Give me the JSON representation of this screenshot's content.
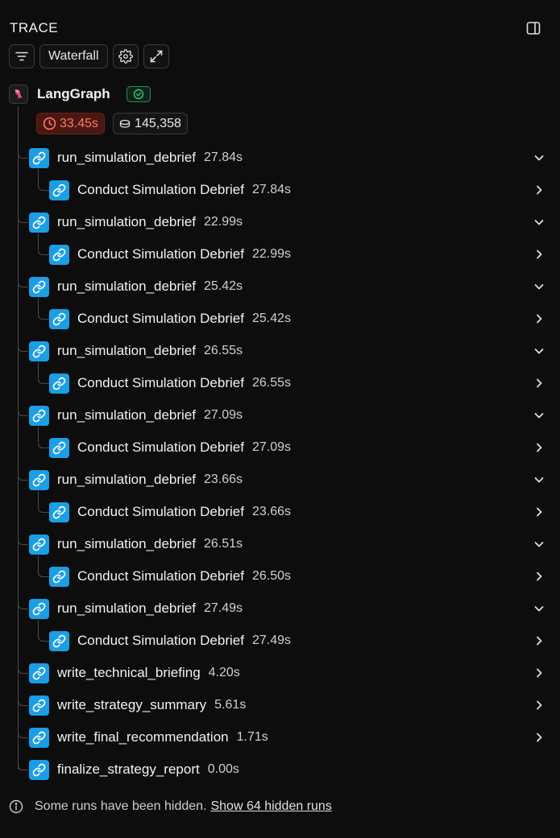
{
  "panel": {
    "title": "TRACE"
  },
  "toolbar": {
    "view_label": "Waterfall"
  },
  "root": {
    "name": "LangGraph",
    "status": "success",
    "duration": "33.45s",
    "tokens": "145,358"
  },
  "runs": [
    {
      "name": "run_simulation_debrief",
      "duration": "27.84s",
      "expanded": true,
      "children": [
        {
          "name": "Conduct Simulation Debrief",
          "duration": "27.84s"
        }
      ]
    },
    {
      "name": "run_simulation_debrief",
      "duration": "22.99s",
      "expanded": true,
      "children": [
        {
          "name": "Conduct Simulation Debrief",
          "duration": "22.99s"
        }
      ]
    },
    {
      "name": "run_simulation_debrief",
      "duration": "25.42s",
      "expanded": true,
      "children": [
        {
          "name": "Conduct Simulation Debrief",
          "duration": "25.42s"
        }
      ]
    },
    {
      "name": "run_simulation_debrief",
      "duration": "26.55s",
      "expanded": true,
      "children": [
        {
          "name": "Conduct Simulation Debrief",
          "duration": "26.55s"
        }
      ]
    },
    {
      "name": "run_simulation_debrief",
      "duration": "27.09s",
      "expanded": true,
      "children": [
        {
          "name": "Conduct Simulation Debrief",
          "duration": "27.09s"
        }
      ]
    },
    {
      "name": "run_simulation_debrief",
      "duration": "23.66s",
      "expanded": true,
      "children": [
        {
          "name": "Conduct Simulation Debrief",
          "duration": "23.66s"
        }
      ]
    },
    {
      "name": "run_simulation_debrief",
      "duration": "26.51s",
      "expanded": true,
      "children": [
        {
          "name": "Conduct Simulation Debrief",
          "duration": "26.50s"
        }
      ]
    },
    {
      "name": "run_simulation_debrief",
      "duration": "27.49s",
      "expanded": true,
      "children": [
        {
          "name": "Conduct Simulation Debrief",
          "duration": "27.49s"
        }
      ]
    },
    {
      "name": "write_technical_briefing",
      "duration": "4.20s",
      "expanded": false,
      "children": []
    },
    {
      "name": "write_strategy_summary",
      "duration": "5.61s",
      "expanded": false,
      "children": []
    },
    {
      "name": "write_final_recommendation",
      "duration": "1.71s",
      "expanded": false,
      "children": []
    },
    {
      "name": "finalize_strategy_report",
      "duration": "0.00s",
      "expanded": false,
      "children": [],
      "leaf": true
    }
  ],
  "footer": {
    "message": "Some runs have been hidden.",
    "link": "Show 64 hidden runs"
  },
  "colors": {
    "accent": "#1a9ee6",
    "error_bg": "#4a1712",
    "error_text": "#ff7b64",
    "success": "#2e8a55"
  }
}
